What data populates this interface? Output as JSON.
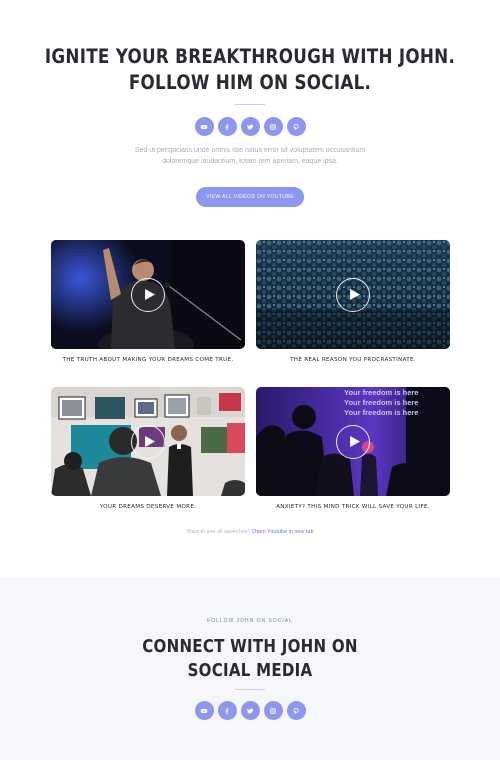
{
  "hero": {
    "title_line1": "IGNITE YOUR BREAKTHROUGH WITH JOHN.",
    "title_line2": "FOLLOW HIM ON SOCIAL.",
    "description": "Sed ut perspiciatis unde omnis iste natus error sit voluptatem accusantium doloremque laudantium, totam rem aperiam, eaque ipsa.",
    "button_label": "VIEW ALL VIDEOS ON YOUTUBE"
  },
  "social_icons": [
    "youtube-icon",
    "facebook-icon",
    "twitter-icon",
    "instagram-icon",
    "pinterest-icon"
  ],
  "videos": [
    {
      "caption": "THE TRUTH ABOUT MAKING YOUR DREAMS COME TRUE."
    },
    {
      "caption": "THE REAL REASON YOU PROCRASTINATE."
    },
    {
      "caption": "YOUR DREAMS DESERVE MORE."
    },
    {
      "caption": "ANXIETY? THIS MIND TRICK WILL SAVE YOUR LIFE.",
      "screen_text": "Your freedom is here"
    }
  ],
  "more": {
    "prompt": "Want to see all speeches?",
    "link_label": "Open Youtube in new tab"
  },
  "connect": {
    "kicker": "FOLLOW JOHN ON SOCIAL",
    "title_line1": "CONNECT WITH JOHN ON",
    "title_line2": "SOCIAL MEDIA"
  },
  "colors": {
    "accent": "#8e97f0",
    "link": "#6c76e8",
    "section_bg": "#f6f7fa"
  }
}
